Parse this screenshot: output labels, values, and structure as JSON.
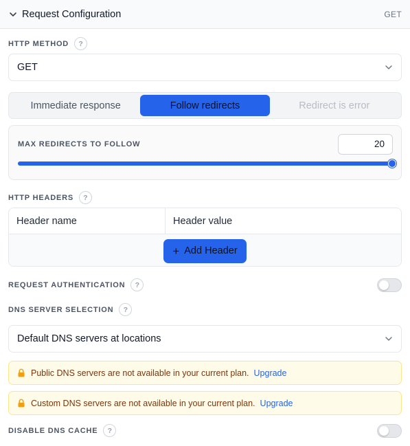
{
  "header": {
    "title": "Request Configuration",
    "method_badge": "GET"
  },
  "http_method": {
    "label": "HTTP METHOD",
    "help": "?",
    "value": "GET"
  },
  "redirect_mode": {
    "options": [
      "Immediate response",
      "Follow redirects",
      "Redirect is error"
    ],
    "selected": "Follow redirects",
    "disabled": [
      "Redirect is error"
    ]
  },
  "max_redirects": {
    "label": "MAX REDIRECTS TO FOLLOW",
    "value": "20",
    "slider_fraction": 1.0
  },
  "http_headers": {
    "label": "HTTP HEADERS",
    "help": "?",
    "name_placeholder": "Header name",
    "value_placeholder": "Header value",
    "add_label": "Add Header",
    "add_icon": "+"
  },
  "request_auth": {
    "label": "REQUEST AUTHENTICATION",
    "help": "?",
    "enabled": false
  },
  "dns_server": {
    "label": "DNS SERVER SELECTION",
    "help": "?",
    "value": "Default DNS servers at locations"
  },
  "notices": [
    {
      "text": "Public DNS servers are not available in your current plan.",
      "link": "Upgrade"
    },
    {
      "text": "Custom DNS servers are not available in your current plan.",
      "link": "Upgrade"
    }
  ],
  "dns_cache": {
    "label": "DISABLE DNS CACHE",
    "help": "?",
    "enabled": false
  },
  "colors": {
    "accent": "#2563eb",
    "notice_bg": "#fefce8",
    "notice_text": "#78350f",
    "lock": "#f59e0b"
  }
}
